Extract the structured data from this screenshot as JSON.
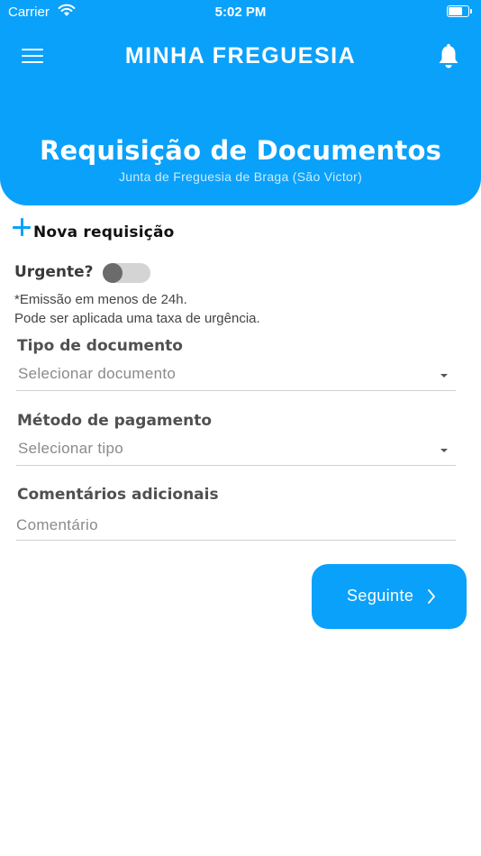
{
  "status_bar": {
    "carrier": "Carrier",
    "time": "5:02 PM"
  },
  "header": {
    "app_title": "MINHA FREGUESIA",
    "page_title": "Requisição de Documentos",
    "subtitle": "Junta de Freguesia de Braga (São Victor)",
    "icons": {
      "menu": "hamburger-menu-icon",
      "notifications": "bell-icon"
    }
  },
  "new_request": {
    "label": "Nova requisição",
    "icon": "plus-icon"
  },
  "urgent": {
    "label": "Urgente?",
    "enabled": false,
    "note_line1": "*Emissão em menos de 24h.",
    "note_line2": "Pode ser aplicada uma taxa de urgência."
  },
  "form": {
    "document_type": {
      "label": "Tipo de documento",
      "value": "Selecionar documento"
    },
    "payment_method": {
      "label": "Método de pagamento",
      "value": "Selecionar tipo"
    },
    "comments": {
      "label": "Comentários adicionais",
      "placeholder": "Comentário"
    }
  },
  "next_button": {
    "label": "Seguinte"
  },
  "colors": {
    "accent": "#0aa1fb",
    "background": "#ffffff"
  }
}
